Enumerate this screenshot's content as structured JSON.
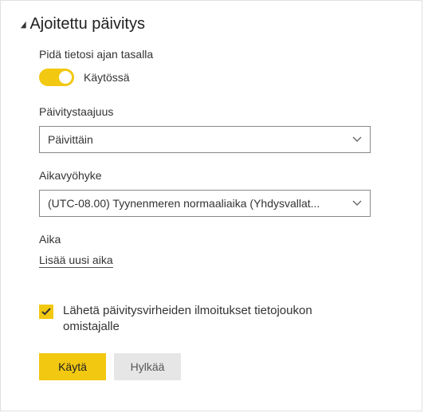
{
  "section": {
    "title": "Ajoitettu päivitys"
  },
  "keepData": {
    "label": "Pidä tietosi ajan tasalla",
    "toggleState": "Käytössä"
  },
  "frequency": {
    "label": "Päivitystaajuus",
    "value": "Päivittäin"
  },
  "timezone": {
    "label": "Aikavyöhyke",
    "value": "(UTC-08.00) Tyynenmeren normaaliaika (Yhdysvallat..."
  },
  "time": {
    "label": "Aika",
    "addLink": "Lisää uusi aika"
  },
  "notify": {
    "label": "Lähetä päivitysvirheiden ilmoitukset tietojoukon omistajalle",
    "checked": true
  },
  "buttons": {
    "apply": "Käytä",
    "discard": "Hylkää"
  }
}
